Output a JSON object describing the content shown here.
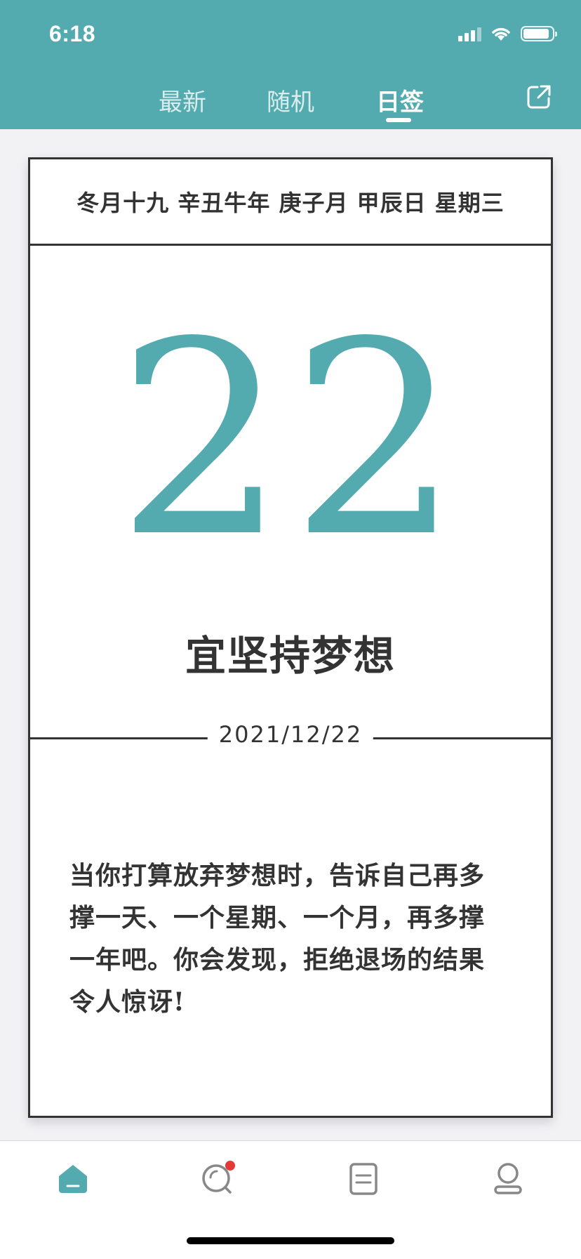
{
  "status_bar": {
    "time": "6:18"
  },
  "header": {
    "tabs": [
      {
        "label": "最新"
      },
      {
        "label": "随机"
      },
      {
        "label": "日签",
        "active": true
      }
    ],
    "share_icon": "share-external-icon"
  },
  "card": {
    "lunar_info": "冬月十九 辛丑牛年 庚子月 甲辰日 星期三",
    "day": "22",
    "yi": "宜坚持梦想",
    "date": "2021/12/22",
    "quote": "当你打算放弃梦想时，告诉自己再多撑一天、一个星期、一个月，再多撑一年吧。你会发现，拒绝退场的结果令人惊讶!"
  },
  "bottom_nav": {
    "items": [
      {
        "icon": "home-icon",
        "active": true
      },
      {
        "icon": "discover-icon",
        "badge": true
      },
      {
        "icon": "document-icon"
      },
      {
        "icon": "profile-icon"
      }
    ]
  },
  "colors": {
    "accent": "#54abaf",
    "badge": "#e53935",
    "text": "#333333"
  }
}
